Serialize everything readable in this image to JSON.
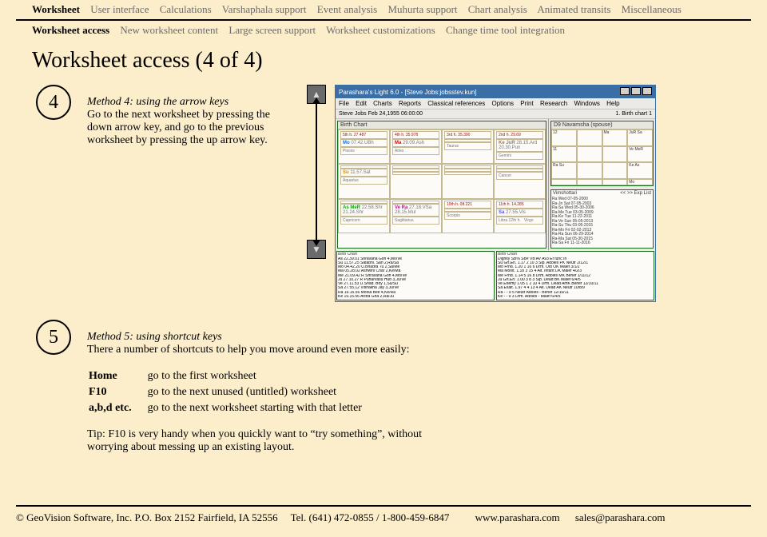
{
  "nav": {
    "top": [
      "Worksheet",
      "User interface",
      "Calculations",
      "Varshaphala support",
      "Event analysis",
      "Muhurta support",
      "Chart analysis",
      "Animated transits",
      "Miscellaneous"
    ],
    "sub": [
      "Worksheet access",
      "New worksheet content",
      "Large screen support",
      "Worksheet customizations",
      "Change time tool integration"
    ]
  },
  "title": "Worksheet access (4 of 4)",
  "method4": {
    "num": "4",
    "heading": "Method 4: using the arrow keys",
    "text": "Go to the next worksheet by pressing the down arrow key, and go to the previous worksheet by pressing the up arrow key."
  },
  "arrows": {
    "up": "▲",
    "down": "▼"
  },
  "app": {
    "title": "Parashara's Light 6.0 - [Steve Jobs:jobsstev.kun]",
    "menus": [
      "File",
      "Edit",
      "Charts",
      "Reports",
      "Classical references",
      "Options",
      "Print",
      "Research",
      "Windows",
      "Help"
    ],
    "toolbar_left": "Steve Jobs   Feb 24,1955   06:00:00",
    "toolbar_right": "1. Birth chart 1",
    "panel_bc": "Birth Chart",
    "panel_d9": "D9 Navamsha  (spouse)",
    "panel_vm": "Vimshottari",
    "vm_ctl": "<<  >>   Exp  List",
    "bc_houses": [
      {
        "h": "5th h. 27.487",
        "pl": "Mo",
        "deg": "07.42.UBh",
        "sign": "Pisces"
      },
      {
        "h": "4th h. 35.978",
        "pl": "Ma",
        "deg": "29.09.Ash",
        "sign": "Aries"
      },
      {
        "h": "3rd h. 35.390",
        "pl": "",
        "deg": "",
        "sign": "Taurus"
      },
      {
        "h": "2nd h. 29.69",
        "pl": "Ke JuR",
        "deg": "28.15.Ard 20.30.Pun",
        "sign": "Gemini"
      },
      {
        "h": "",
        "pl": "Su",
        "deg": "11.57.Sat",
        "sign": "Aquarius"
      },
      {
        "h": "",
        "pl": "",
        "deg": "",
        "sign": ""
      },
      {
        "h": "",
        "pl": "",
        "deg": "",
        "sign": ""
      },
      {
        "h": "",
        "pl": "",
        "deg": "",
        "sign": "Cancer"
      },
      {
        "h": "",
        "pl": "As MeR",
        "deg": "22.58.Shr 21.24.Shr",
        "sign": "Capricorn"
      },
      {
        "h": "",
        "pl": "Ve Ra",
        "deg": "27.18.VSa 28.15.Mul",
        "sign": "Sagittarius"
      },
      {
        "h": "10th h. 08.221",
        "pl": "",
        "deg": "",
        "sign": "Scorpio"
      },
      {
        "h": "11th h. 14.285",
        "pl": "Sa",
        "deg": "27.55.Vis",
        "sign": "Libra  12th h.",
        "extra": "Virgo"
      }
    ],
    "d9": [
      "12",
      "",
      "Ma",
      "JuR  Sa",
      "11",
      "",
      "",
      "Ve MeR",
      "Ra Su",
      "",
      "",
      "Ke As",
      "",
      "",
      "",
      "Mo"
    ],
    "vm": [
      "Ra  Wed 07-05-2000",
      "Ra-Jn  Sat  07-05-2003",
      "Ra-Sa  Wed 05-30-2006",
      "Ra-Me  Tue  03-05-2009",
      "Ra-Ke  Tue  11-22-2011",
      "Ra-Ve  Sun  05-05-2013",
      "Ra-Su  Thu  03-05-2015",
      "Ra-Mo  Fri   02-02-2013",
      "Ra-Ra  Sun  06-29-2014",
      "Ra-Ma  Sat  05-30-2015",
      "Ra-Sa  Fri   11-11-2016"
    ],
    "tbl_l_title": "Birth Chart",
    "tbl_r_title": "Birth Chart",
    "tbl_l": [
      "As 22.39.01   Shravana  Goh   4,Mo/Ve",
      "Su 11.57.25   Satabhi.  Sah   2,Ra/Sa",
      "Mo 04.42.20   U.Bhadra  Tu    2,Sa/Me",
      "Ma 05.28.02   Ashwini   Char  2,Ke/Ma",
      "Me 21.09.42 R Shravana  Goh   4,Mo/Ve",
      "Ju 27.10.27 R Punarvasu Hub   3,Ju/Ve",
      "Ve 27.11.53   U.Shad.   Boy   1,Su/Su",
      "Sa 27.55.12   Vishakha  Jay   3,Ju/Ve",
      "Ra 19.15.56   Moola     Bee   4,Ke/Ra",
      "Ke 19.15.56   Ardra     Gha   2,Ra/Ju"
    ],
    "tbl_r": [
      "   Dignity SB% SB# VB  AV Av3  Ef   func  In",
      "Su Grt.En. 1.17 2  10  3  Slp. Adoles PK  Neutr 2/12/1",
      "Mo Frnd.   1.20 1  16  6  Drm. Old    OK  Malef 3/1/2",
      "Ma Moolt.  1.18 3  15  4  Alt. Infant DK  Malef 4/2/3",
      "Me Frnd.   1.14 5  16  8  Drm. Adoles MK  Benef 1/11/12",
      "Ju Grt.En. 1.00 3   8  3  Slp. Dead   BK  Malef 6/4/5",
      "Ve Enemy   1.05 1   2  10 4  Drm. Dead  AmK Benef 12/10/11",
      "Sa Exalt.  1.97 4   4  13 4  Alt. Dead  AK  Neutr 10/8/9",
      "Ra        -    -   9  5  Neutr Adoles  -  Benef 12/10/11",
      "Ke        -    -   9  3  Drm. Adoles   -  Malef 6/4/5"
    ]
  },
  "method5": {
    "num": "5",
    "heading": "Method 5: using shortcut keys",
    "intro": "There a number of shortcuts to help you move around even more easily:",
    "rows": [
      [
        "Home",
        "go to the first worksheet"
      ],
      [
        "F10",
        "go to the next unused (untitled) worksheet"
      ],
      [
        "a,b,d etc.",
        "go to the next worksheet starting with that letter"
      ]
    ],
    "tip": "Tip:  F10 is very handy when you quickly want to “try something”, without worrying about messing up an existing layout."
  },
  "footer": {
    "copy": "© GeoVision Software, Inc. P.O. Box 2152 Fairfield, IA 52556",
    "tel": "Tel. (641) 472-0855 / 1-800-459-6847",
    "site": "www.parashara.com",
    "email": "sales@parashara.com"
  }
}
